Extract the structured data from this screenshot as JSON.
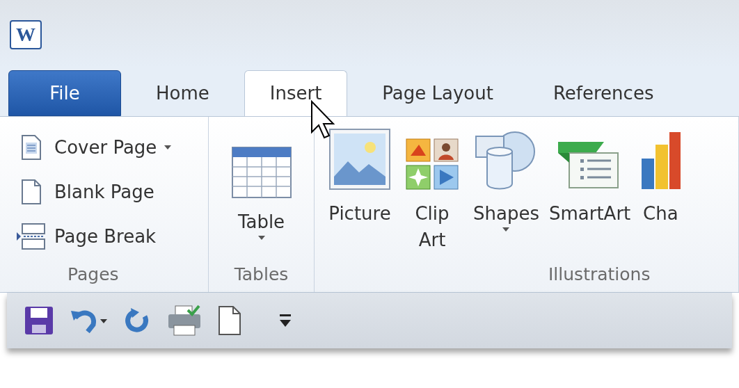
{
  "app_icon": {
    "letter": "W"
  },
  "tabs": [
    {
      "label": "File",
      "kind": "file",
      "selected": false
    },
    {
      "label": "Home",
      "kind": "tab",
      "selected": false
    },
    {
      "label": "Insert",
      "kind": "tab",
      "selected": true
    },
    {
      "label": "Page Layout",
      "kind": "tab",
      "selected": false
    },
    {
      "label": "References",
      "kind": "tab",
      "selected": false
    }
  ],
  "groups": [
    {
      "label": "Pages",
      "items": [
        {
          "label": "Cover Page",
          "kind": "small",
          "dropdown": true
        },
        {
          "label": "Blank Page",
          "kind": "small",
          "dropdown": false
        },
        {
          "label": "Page Break",
          "kind": "small",
          "dropdown": false
        }
      ]
    },
    {
      "label": "Tables",
      "items": [
        {
          "label": "Table",
          "kind": "large",
          "dropdown": true
        }
      ]
    },
    {
      "label": "Illustrations",
      "items": [
        {
          "label": "Picture",
          "kind": "large",
          "dropdown": false
        },
        {
          "label": "Clip Art",
          "kind": "large",
          "dropdown": false
        },
        {
          "label": "Shapes",
          "kind": "large",
          "dropdown": true
        },
        {
          "label": "SmartArt",
          "kind": "large",
          "dropdown": false
        },
        {
          "label": "Cha",
          "kind": "large",
          "dropdown": false
        }
      ]
    }
  ]
}
